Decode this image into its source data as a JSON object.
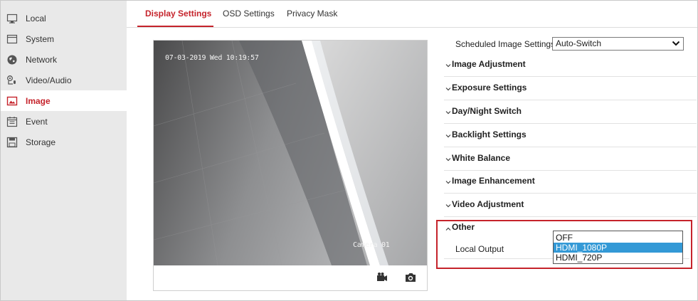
{
  "sidebar": {
    "items": [
      {
        "label": "Local",
        "icon": "monitor-icon"
      },
      {
        "label": "System",
        "icon": "window-icon"
      },
      {
        "label": "Network",
        "icon": "globe-icon"
      },
      {
        "label": "Video/Audio",
        "icon": "camera-mic-icon"
      },
      {
        "label": "Image",
        "icon": "image-icon",
        "active": true
      },
      {
        "label": "Event",
        "icon": "calendar-icon"
      },
      {
        "label": "Storage",
        "icon": "disk-icon"
      }
    ]
  },
  "tabs": [
    {
      "label": "Display Settings",
      "active": true
    },
    {
      "label": "OSD Settings"
    },
    {
      "label": "Privacy Mask"
    }
  ],
  "video": {
    "osd_time": "07-03-2019 Wed 10:19:57",
    "osd_name": "Camera 01"
  },
  "toolbar": {
    "record_icon": "record-icon",
    "snapshot_icon": "snapshot-icon"
  },
  "settings": {
    "scheduled_label": "Scheduled Image Settings",
    "scheduled_value": "Auto-Switch",
    "sections": [
      "Image Adjustment",
      "Exposure Settings",
      "Day/Night Switch",
      "Backlight Settings",
      "White Balance",
      "Image Enhancement",
      "Video Adjustment"
    ],
    "other_label": "Other",
    "local_output_label": "Local Output",
    "local_output_options": [
      "OFF",
      "HDMI_1080P",
      "HDMI_720P"
    ],
    "local_output_selected": "HDMI_1080P"
  },
  "colors": {
    "accent": "#c5232b",
    "selection": "#3399d6",
    "sidebar_bg": "#e9e9e9"
  }
}
